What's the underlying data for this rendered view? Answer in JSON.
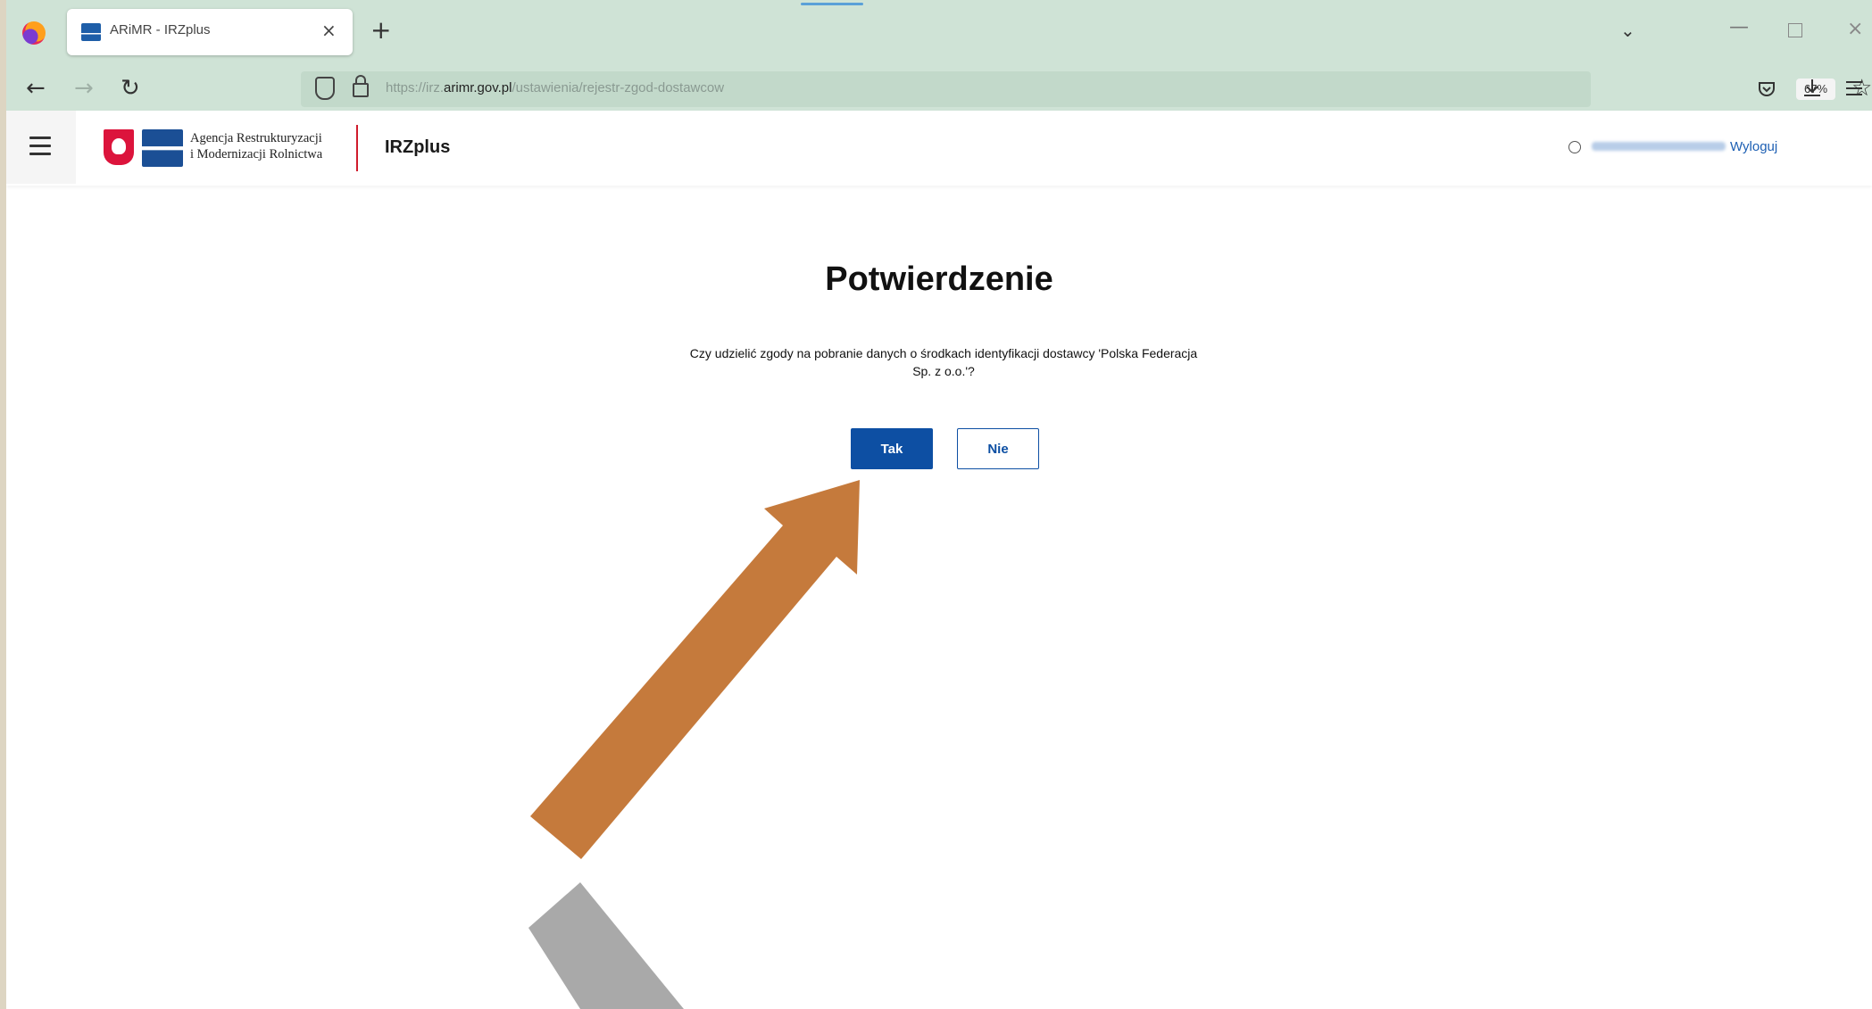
{
  "browser": {
    "tab_title": "ARiMR - IRZplus",
    "tab_close": "×",
    "new_tab": "+",
    "url_prefix": "https://irz.",
    "url_domain": "arimr.gov.pl",
    "url_path": "/ustawienia/rejestr-zgod-dostawcow",
    "zoom": "67%",
    "icons": {
      "back": "back-arrow-icon",
      "forward": "forward-arrow-icon",
      "reload": "reload-icon",
      "shield": "shield-icon",
      "lock": "lock-icon",
      "star": "star-icon",
      "pocket": "pocket-icon",
      "download": "download-icon",
      "menu": "hamburger-menu-icon"
    }
  },
  "header": {
    "agency_line1": "Agencja Restrukturyzacji",
    "agency_line2": "i Modernizacji Rolnictwa",
    "app_name": "IRZplus",
    "logout": "Wyloguj"
  },
  "dialog": {
    "title": "Potwierdzenie",
    "question_line1": "Czy udzielić zgody na pobranie danych o środkach identyfikacji dostawcy 'Polska Federacja",
    "question_line2": "Sp. z o.o.'?",
    "yes_label": "Tak",
    "no_label": "Nie"
  },
  "colors": {
    "primary": "#0d4fa3",
    "arrow": "#c57a3c",
    "divider_red": "#d01c2c"
  }
}
